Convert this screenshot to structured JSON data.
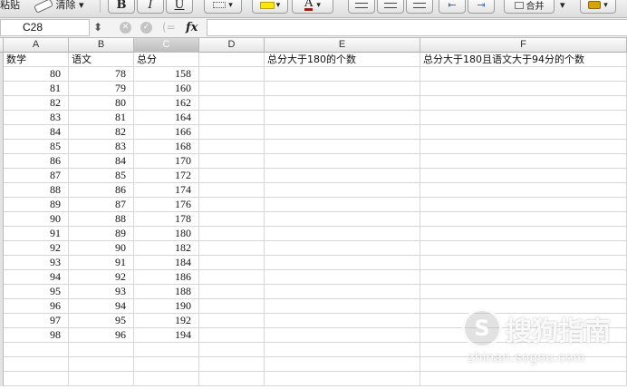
{
  "toolbar": {
    "paste_label": "粘贴",
    "clear_label": "清除",
    "merge_label": "合并",
    "bold_label": "B",
    "italic_label": "I",
    "underline_label": "U",
    "font_color_label": "A"
  },
  "formula_bar": {
    "cell_reference": "C28",
    "fx_label": "fx",
    "formula": ""
  },
  "columns": [
    "A",
    "B",
    "C",
    "D",
    "E",
    "F"
  ],
  "headers": [
    "数学",
    "语文",
    "总分",
    "",
    "总分大于180的个数",
    "总分大于180且语文大于94分的个数"
  ],
  "rows": [
    [
      80,
      78,
      158
    ],
    [
      81,
      79,
      160
    ],
    [
      82,
      80,
      162
    ],
    [
      83,
      81,
      164
    ],
    [
      84,
      82,
      166
    ],
    [
      85,
      83,
      168
    ],
    [
      86,
      84,
      170
    ],
    [
      87,
      85,
      172
    ],
    [
      88,
      86,
      174
    ],
    [
      89,
      87,
      176
    ],
    [
      90,
      88,
      178
    ],
    [
      91,
      89,
      180
    ],
    [
      92,
      90,
      182
    ],
    [
      93,
      91,
      184
    ],
    [
      94,
      92,
      186
    ],
    [
      95,
      93,
      188
    ],
    [
      96,
      94,
      190
    ],
    [
      97,
      95,
      192
    ],
    [
      98,
      96,
      194
    ]
  ],
  "watermark": {
    "text": "搜狗指南",
    "url": "zhinan.sogou.com"
  },
  "colors": {
    "selected_header": "#c4c4c4",
    "grid_line": "#d6d6d6",
    "font_color_accent": "#e00000",
    "highlight_accent": "#ffe600"
  }
}
